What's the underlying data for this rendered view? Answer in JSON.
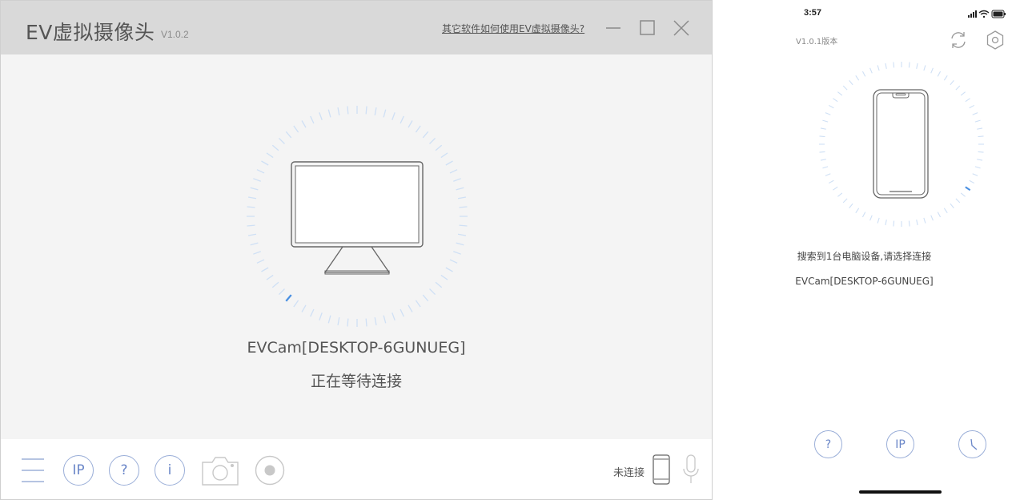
{
  "desktop": {
    "title": "EV虚拟摄像头",
    "version": "V1.0.2",
    "help_link": "其它软件如何使用EV虚拟摄像头?",
    "device_name": "EVCam[DESKTOP-6GUNUEG]",
    "status": "正在等待连接",
    "footer": {
      "ip_label": "IP",
      "help_label": "?",
      "info_label": "i",
      "connection_status": "未连接"
    }
  },
  "phone": {
    "time": "3:57",
    "version": "V1.0.1版本",
    "search_status": "搜索到1台电脑设备,请选择连接",
    "device_name": "EVCam[DESKTOP-6GUNUEG]",
    "buttons": {
      "help_label": "?",
      "ip_label": "IP"
    }
  },
  "colors": {
    "accent": "#4a90e2",
    "tick": "#cfe0f5",
    "titlebar": "#d9d9d9"
  }
}
